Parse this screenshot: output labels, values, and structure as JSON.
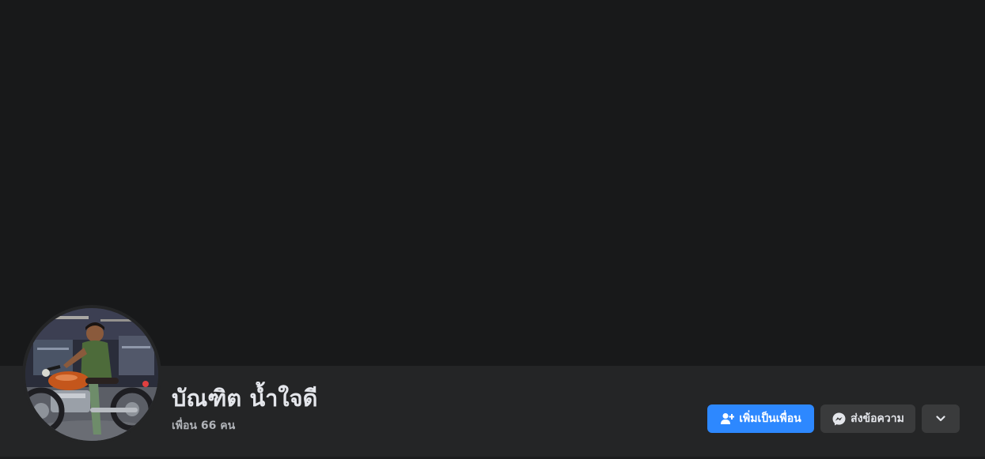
{
  "profile": {
    "name": "บัณฑิต น้ำใจดี",
    "friends_count": "เพื่อน 66 คน"
  },
  "actions": {
    "add_friend_label": "เพิ่มเป็นเพื่อน",
    "message_label": "ส่งข้อความ"
  },
  "icons": {
    "add_friend": "person-add-icon",
    "message": "messenger-icon",
    "more": "chevron-down-icon"
  },
  "colors": {
    "accent": "#2d88ff",
    "cover": "#18191a",
    "surface": "#242526",
    "button_secondary": "#3a3b3c",
    "text_primary": "#e4e6eb",
    "text_secondary": "#b0b3b8"
  }
}
